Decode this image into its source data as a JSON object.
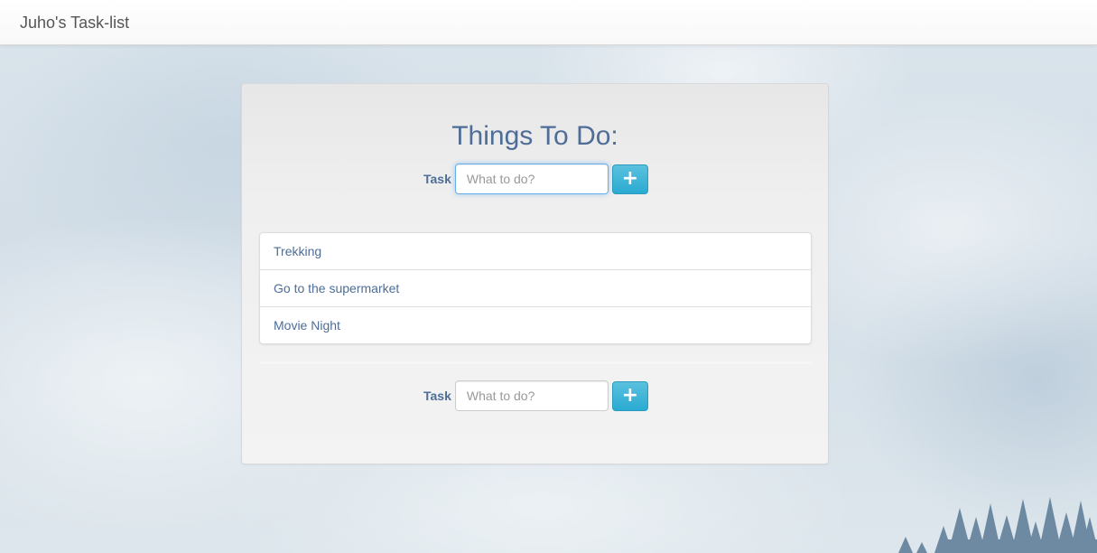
{
  "navbar": {
    "brand": "Juho's Task-list"
  },
  "panel": {
    "title": "Things To Do:"
  },
  "form_top": {
    "label": "Task",
    "placeholder": "What to do?",
    "value": "",
    "button_icon": "plus-icon",
    "button_glyph": "+"
  },
  "tasks": [
    {
      "label": "Trekking"
    },
    {
      "label": "Go to the supermarket"
    },
    {
      "label": "Movie Night"
    }
  ],
  "form_bottom": {
    "label": "Task",
    "placeholder": "What to do?",
    "value": "",
    "button_icon": "plus-icon",
    "button_glyph": "+"
  },
  "colors": {
    "accent": "#5bc0de",
    "text_primary": "#4e6d97",
    "brand_text": "#555555"
  }
}
